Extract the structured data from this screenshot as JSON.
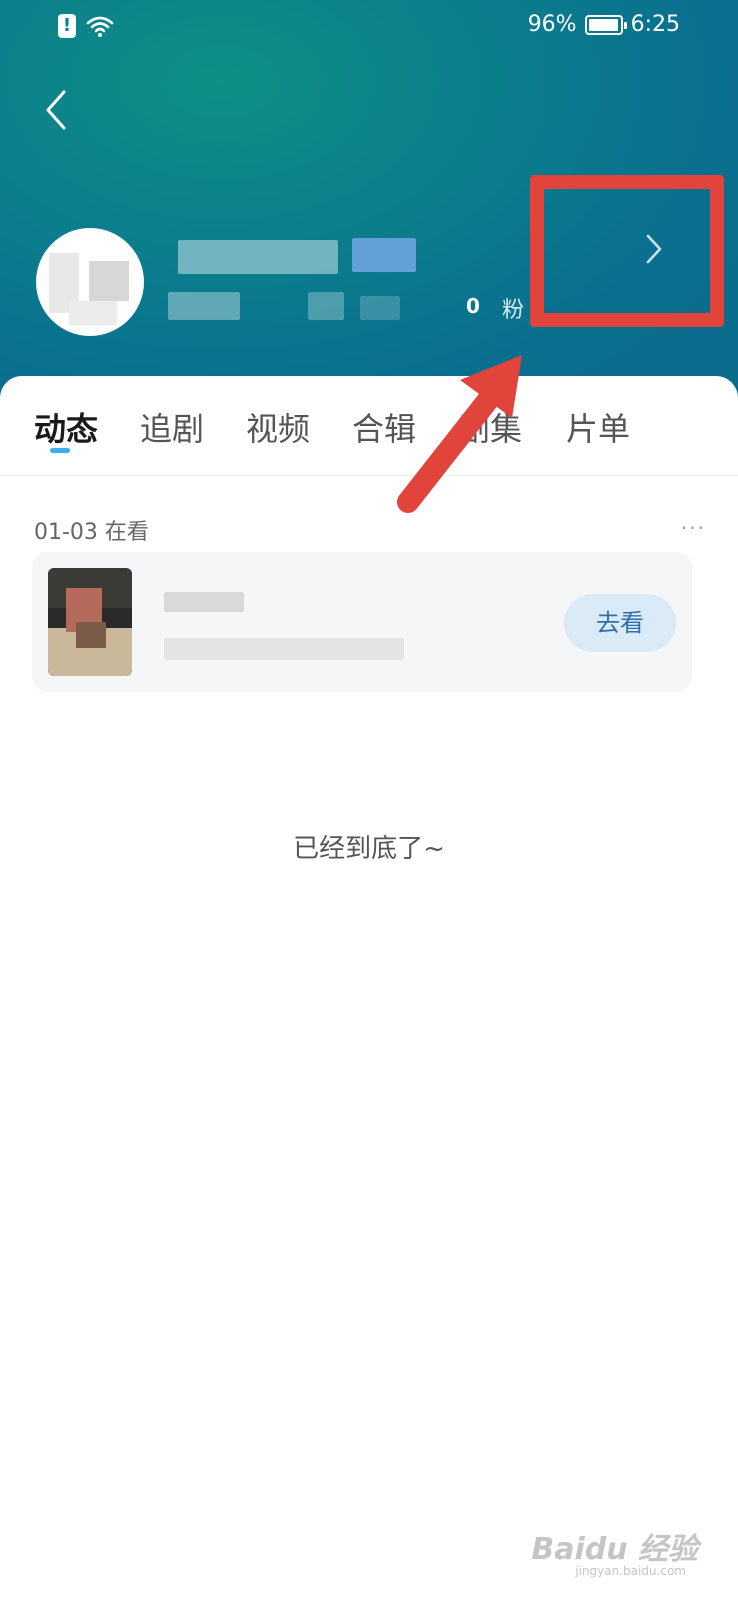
{
  "status_bar": {
    "battery": "96%",
    "time": "6:25",
    "alert_glyph": "!"
  },
  "profile": {
    "fans_count": "0",
    "fans_label": "粉"
  },
  "tabs": [
    {
      "label": "动态",
      "active": true
    },
    {
      "label": "追剧",
      "active": false
    },
    {
      "label": "视频",
      "active": false
    },
    {
      "label": "合辑",
      "active": false
    },
    {
      "label": "剧集",
      "active": false
    },
    {
      "label": "片单",
      "active": false
    }
  ],
  "feed": {
    "date_label": "01-03 在看",
    "more_glyph": "···",
    "watch_button": "去看"
  },
  "end_text": "已经到底了~",
  "watermark": {
    "brand": "Baidu 经验",
    "url": "jingyan.baidu.com"
  },
  "colors": {
    "header": "#0b7f8c",
    "highlight": "#e0443a",
    "tab_indicator": "#3ab0e8",
    "watch_button_bg": "#dbeaf7"
  },
  "icons": [
    "alert-icon",
    "wifi-icon",
    "battery-icon",
    "back-arrow-icon",
    "chevron-right-icon",
    "more-dots-icon"
  ]
}
